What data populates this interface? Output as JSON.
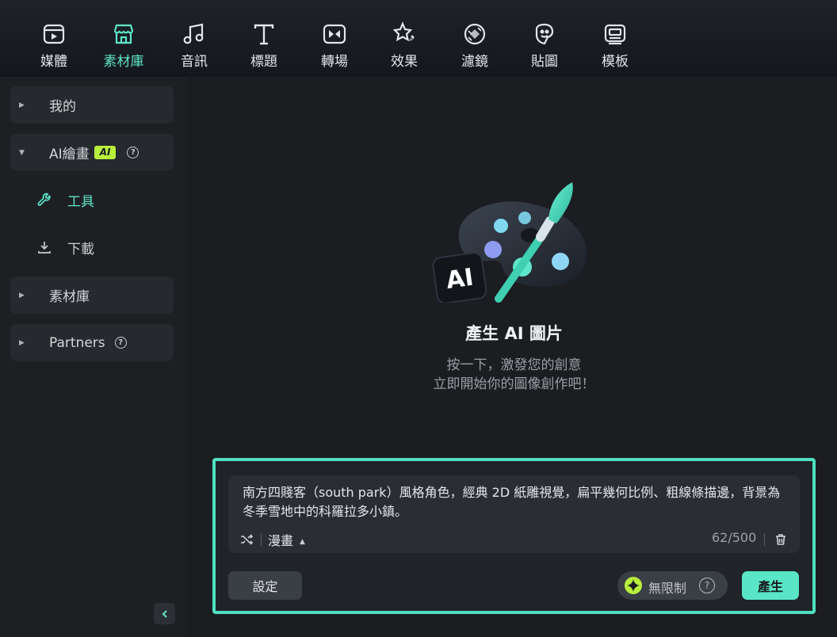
{
  "toolbar": {
    "items": [
      {
        "label": "媒體",
        "icon": "media-icon"
      },
      {
        "label": "素材庫",
        "icon": "store-icon"
      },
      {
        "label": "音訊",
        "icon": "music-note-icon"
      },
      {
        "label": "標題",
        "icon": "text-icon"
      },
      {
        "label": "轉場",
        "icon": "transition-icon"
      },
      {
        "label": "效果",
        "icon": "effects-star-icon"
      },
      {
        "label": "濾鏡",
        "icon": "filter-icon"
      },
      {
        "label": "貼圖",
        "icon": "sticker-icon"
      },
      {
        "label": "模板",
        "icon": "template-icon"
      }
    ],
    "active_index": 1
  },
  "sidebar": {
    "my": "我的",
    "ai_drawing": "AI繪畫",
    "ai_badge": "AI",
    "tools": "工具",
    "download": "下載",
    "library": "素材庫",
    "partners": "Partners"
  },
  "main": {
    "title": "產生 AI 圖片",
    "subtitle_line1": "按一下，激發您的創意",
    "subtitle_line2": "立即開始你的圖像創作吧！",
    "illustration_badge": "AI"
  },
  "prompt": {
    "text": "南方四賤客（south park）風格角色，經典 2D 紙雕視覺，扁平幾何比例、粗線條描邊，背景為冬季雪地中的科羅拉多小鎮。",
    "style": "漫畫",
    "counter": "62/500"
  },
  "actions": {
    "settings": "設定",
    "unlimited": "無限制",
    "generate": "產生"
  },
  "colors": {
    "accent": "#5fe6c9",
    "ai_badge": "#b8ef3c",
    "panel_border": "#50e0c1"
  }
}
